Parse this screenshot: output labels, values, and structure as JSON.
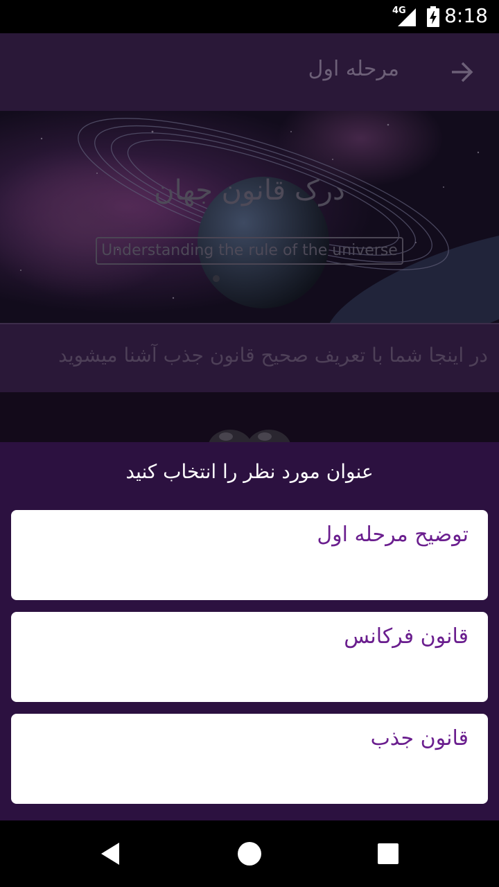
{
  "status_bar": {
    "network_label": "4G",
    "time": "8:18"
  },
  "app_bar": {
    "title": "مرحله اول",
    "back_icon": "arrow-forward-icon"
  },
  "banner": {
    "title": "درک قانون جهان",
    "subtitle": "Understanding the rule of the universe"
  },
  "description": "در اینجا شما با تعریف صحیح قانون جذب آشنا میشوید",
  "dialog": {
    "title": "عنوان مورد نظر را انتخاب کنید",
    "options": [
      {
        "label": "توضیح مرحله اول"
      },
      {
        "label": "قانون فرکانس"
      },
      {
        "label": "قانون جذب"
      }
    ]
  },
  "nav_bar": {
    "back": "nav-back-icon",
    "home": "nav-home-icon",
    "recents": "nav-recents-icon"
  },
  "colors": {
    "sheet_background": "#2c1140",
    "option_text": "#6a1e8e",
    "app_bar": "#2a1838"
  }
}
